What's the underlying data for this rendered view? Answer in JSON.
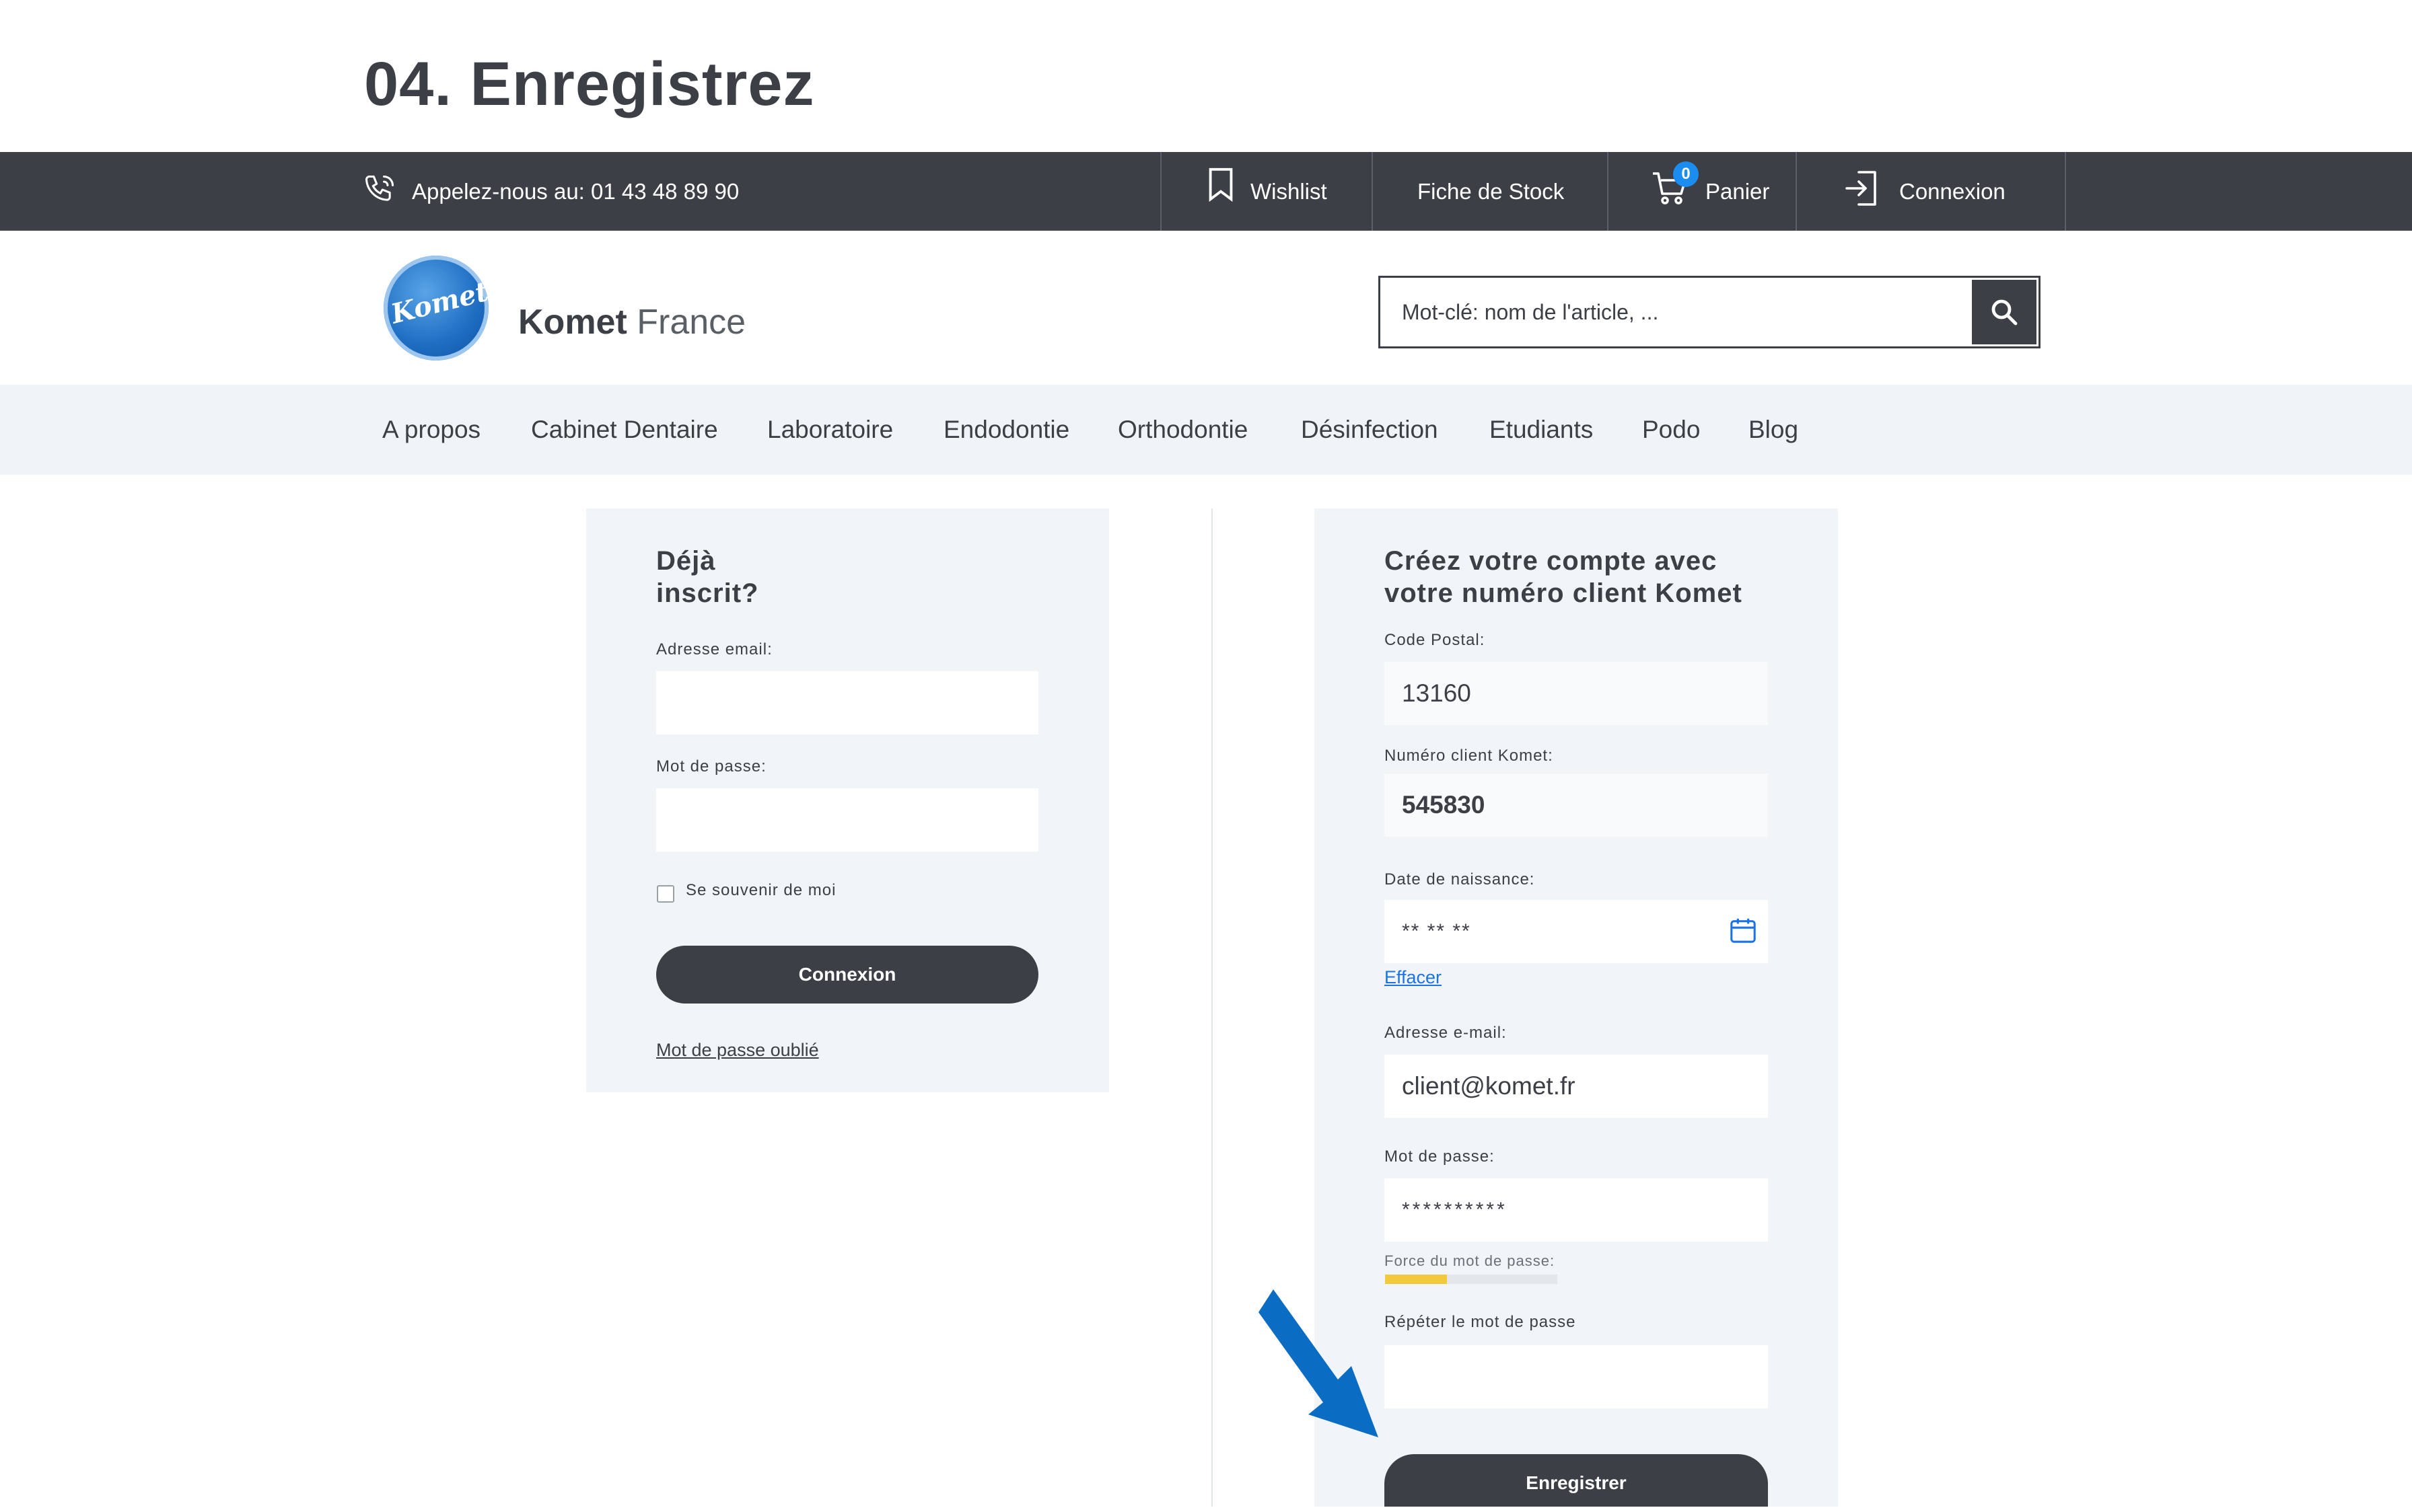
{
  "step_title": "04. Enregistrez",
  "topbar": {
    "phone_text": "Appelez-nous au: 01 43 48 89 90",
    "wishlist": "Wishlist",
    "stock": "Fiche de Stock",
    "cart": "Panier",
    "cart_count": "0",
    "login": "Connexion",
    "icons": [
      "phone-icon",
      "bookmark-icon",
      "cart-icon",
      "login-icon"
    ]
  },
  "header": {
    "logo_text": "Komet",
    "brand_bold": "Komet",
    "brand_light": "France",
    "search_placeholder": "Mot-clé: nom de l'article, ..."
  },
  "nav": {
    "items": [
      "A propos",
      "Cabinet Dentaire",
      "Laboratoire",
      "Endodontie",
      "Orthodontie",
      "Désinfection",
      "Etudiants",
      "Podo",
      "Blog"
    ]
  },
  "login": {
    "title_line1": "Déjà",
    "title_line2": "inscrit?",
    "email_label": "Adresse email:",
    "email_value": "",
    "password_label": "Mot de passe:",
    "password_value": "",
    "remember_label": "Se souvenir de moi",
    "submit": "Connexion",
    "forgot": "Mot de passe oublié"
  },
  "register": {
    "title_line1": "Créez votre compte avec",
    "title_line2": "votre numéro client Komet",
    "postal_label": "Code Postal:",
    "postal_value": "13160",
    "client_label": "Numéro client Komet:",
    "client_value": "545830",
    "birth_label": "Date de naissance:",
    "birth_value": "** ** **",
    "clear_link": "Effacer",
    "email_label": "Adresse e-mail:",
    "email_value": "client@komet.fr",
    "password_label": "Mot de passe:",
    "password_value": "**********",
    "strength_label": "Force du mot de passe:",
    "strength_fraction": 0.36,
    "repeat_label": "Répéter le mot de passe",
    "repeat_value": "",
    "submit": "Enregistrer"
  },
  "colors": {
    "dark": "#3c4046",
    "accent_blue": "#0a6cc2",
    "strength_yellow": "#f1c93b",
    "link_blue": "#1a73e8",
    "cart_badge": "#1b8cf0"
  }
}
